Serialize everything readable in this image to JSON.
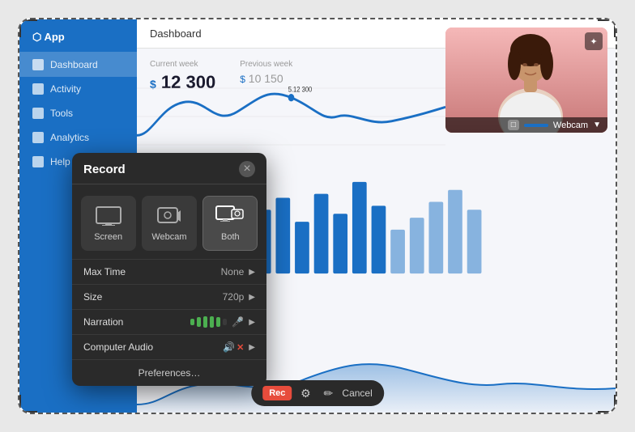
{
  "frame": {
    "title": "Dashboard"
  },
  "sidebar": {
    "items": [
      {
        "label": "Dashboard",
        "active": true
      },
      {
        "label": "Activity",
        "active": false
      },
      {
        "label": "Tools",
        "active": false
      },
      {
        "label": "Analytics",
        "active": false
      },
      {
        "label": "Help",
        "active": false
      }
    ]
  },
  "dashboard": {
    "topbar_title": "Dashboard",
    "stats": [
      {
        "label": "Current week",
        "prefix": "$",
        "value": "12 300"
      },
      {
        "label": "Previous week",
        "prefix": "$",
        "value": "10 150"
      }
    ]
  },
  "webcam": {
    "label": "Webcam",
    "edit_icon": "✦"
  },
  "record_panel": {
    "title": "Record",
    "close_label": "×",
    "sources": [
      {
        "label": "Screen",
        "active": false
      },
      {
        "label": "Webcam",
        "active": false
      },
      {
        "label": "Both",
        "active": true
      }
    ],
    "settings": [
      {
        "label": "Max Time",
        "value": "None"
      },
      {
        "label": "Size",
        "value": "720p"
      },
      {
        "label": "Narration",
        "value": ""
      },
      {
        "label": "Computer Audio",
        "value": ""
      }
    ],
    "preferences_label": "Preferences…"
  },
  "bottom_toolbar": {
    "rec_label": "Rec",
    "cancel_label": "Cancel"
  }
}
